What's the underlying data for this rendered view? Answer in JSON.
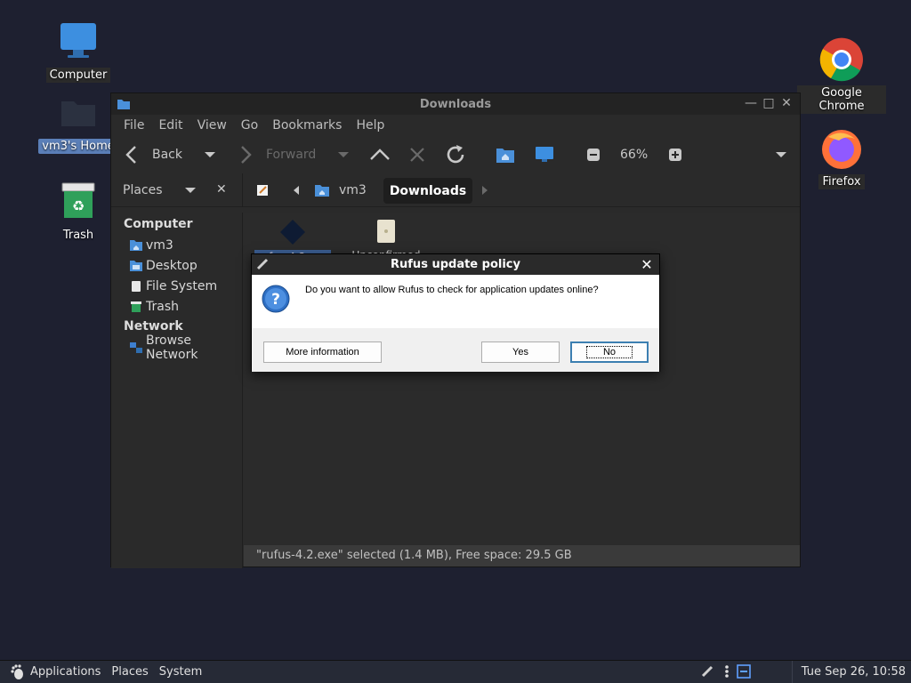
{
  "desktop": {
    "icons": [
      {
        "label": "Computer"
      },
      {
        "label": "vm3's Home"
      },
      {
        "label": "Trash"
      },
      {
        "label": "Google Chrome"
      },
      {
        "label": "Firefox"
      }
    ]
  },
  "file_manager": {
    "title": "Downloads",
    "menu": [
      "File",
      "Edit",
      "View",
      "Go",
      "Bookmarks",
      "Help"
    ],
    "toolbar": {
      "back_label": "Back",
      "forward_label": "Forward",
      "zoom_level": "66%"
    },
    "sidebar": {
      "header": "Places",
      "sections": [
        {
          "title": "Computer",
          "items": [
            "vm3",
            "Desktop",
            "File System",
            "Trash"
          ]
        },
        {
          "title": "Network",
          "items": [
            "Browse Network"
          ]
        }
      ]
    },
    "breadcrumb": [
      "vm3",
      "Downloads"
    ],
    "files": [
      {
        "name": "rufus-4.2.exe",
        "selected": true
      },
      {
        "name": "Unconfirmed",
        "selected": false
      }
    ],
    "status": "\"rufus-4.2.exe\" selected (1.4 MB), Free space: 29.5 GB"
  },
  "dialog": {
    "title": "Rufus update policy",
    "message": "Do you want to allow Rufus to check for application updates online?",
    "buttons": {
      "more_info": "More information",
      "yes": "Yes",
      "no": "No"
    }
  },
  "panel": {
    "menus": [
      "Applications",
      "Places",
      "System"
    ],
    "clock": "Tue Sep 26, 10:58"
  },
  "colors": {
    "desktop_bg": "#1e2030",
    "window_bg": "#2a2a2a",
    "selection": "#5b7fb8",
    "folder_blue": "#4a90d9"
  }
}
